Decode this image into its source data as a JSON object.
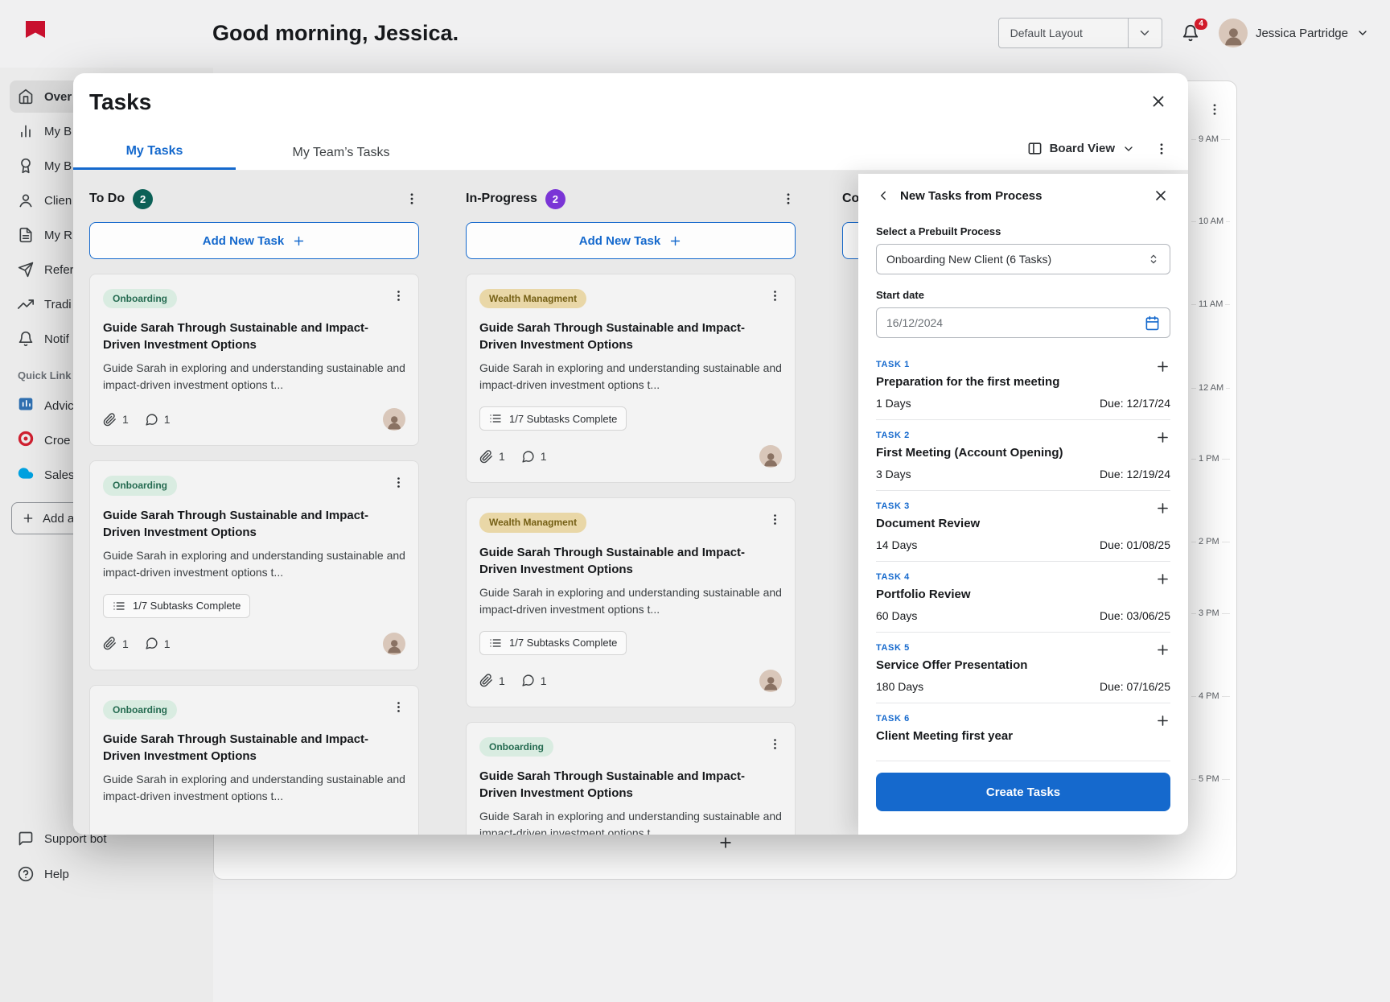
{
  "colors": {
    "accent": "#1569cd",
    "todo_badge": "#0c6157",
    "inprogress_badge": "#7a35d6",
    "onboarding_tag_bg": "#d9ece1",
    "onboarding_tag_text": "#256b51",
    "wealth_tag_bg": "#e9d7a7",
    "wealth_tag_text": "#756016",
    "notification_badge": "#d11a2a",
    "logo_red": "#c8102e"
  },
  "header": {
    "greeting": "Good morning, Jessica.",
    "layout_select": "Default Layout",
    "notification_count": "4",
    "user_name": "Jessica Partridge"
  },
  "sidebar": {
    "items": [
      {
        "label": "Over"
      },
      {
        "label": "My B"
      },
      {
        "label": "My B"
      },
      {
        "label": "Clien"
      },
      {
        "label": "My R"
      },
      {
        "label": "Refer"
      },
      {
        "label": "Tradi"
      },
      {
        "label": "Notif"
      }
    ],
    "section_label": "Quick Link",
    "quick_links": [
      {
        "label": "Advic"
      },
      {
        "label": "Croe"
      },
      {
        "label": "Sales"
      }
    ],
    "add_button_label": "Add a",
    "support_label": "Support bot",
    "help_label": "Help"
  },
  "timeline": {
    "times": [
      "9 AM",
      "10 AM",
      "11 AM",
      "12 AM",
      "1 PM",
      "2 PM",
      "3 PM",
      "4 PM",
      "5 PM"
    ]
  },
  "modal": {
    "title": "Tasks",
    "tabs": [
      {
        "label": "My Tasks"
      },
      {
        "label": "My Team’s Tasks"
      }
    ],
    "view_label": "Board View",
    "add_task_label": "Add New Task",
    "columns": [
      {
        "name": "To Do",
        "count": "2",
        "cards": [
          {
            "tag": "Onboarding",
            "title": "Guide Sarah Through Sustainable and Impact-Driven Investment Options",
            "desc": "Guide Sarah in exploring and understanding sustainable and impact-driven investment options t...",
            "attachments": "1",
            "comments": "1"
          },
          {
            "tag": "Onboarding",
            "title": "Guide Sarah Through Sustainable and Impact-Driven Investment Options",
            "desc": "Guide Sarah in exploring and understanding sustainable and impact-driven investment options t...",
            "subtasks": "1/7 Subtasks Complete",
            "attachments": "1",
            "comments": "1"
          },
          {
            "tag": "Onboarding",
            "title": "Guide Sarah Through Sustainable and Impact-Driven Investment Options",
            "desc": "Guide Sarah in exploring and understanding sustainable and impact-driven investment options t..."
          }
        ]
      },
      {
        "name": "In-Progress",
        "count": "2",
        "cards": [
          {
            "tag": "Wealth Managment",
            "title": "Guide Sarah Through Sustainable and Impact-Driven Investment Options",
            "desc": "Guide Sarah in exploring and understanding sustainable and impact-driven investment options t...",
            "subtasks": "1/7 Subtasks Complete",
            "attachments": "1",
            "comments": "1"
          },
          {
            "tag": "Wealth Managment",
            "title": "Guide Sarah Through Sustainable and Impact-Driven Investment Options",
            "desc": "Guide Sarah in exploring and understanding sustainable and impact-driven investment options t...",
            "subtasks": "1/7 Subtasks Complete",
            "attachments": "1",
            "comments": "1"
          },
          {
            "tag": "Onboarding",
            "title": "Guide Sarah Through Sustainable and Impact-Driven Investment Options",
            "desc": "Guide Sarah in exploring and understanding sustainable and impact-driven investment options t..."
          }
        ]
      },
      {
        "name": "Completed",
        "count": "",
        "cards": []
      }
    ]
  },
  "panel": {
    "title": "New Tasks from Process",
    "process_label": "Select a Prebuilt Process",
    "process_value": "Onboarding New Client (6 Tasks)",
    "start_date_label": "Start date",
    "start_date_value": "16/12/2024",
    "tasks": [
      {
        "num": "TASK 1",
        "title": "Preparation for the first meeting",
        "days": "1 Days",
        "due": "Due: 12/17/24"
      },
      {
        "num": "TASK 2",
        "title": "First Meeting (Account Opening)",
        "days": "3 Days",
        "due": "Due: 12/19/24"
      },
      {
        "num": "TASK 3",
        "title": "Document Review",
        "days": "14 Days",
        "due": "Due: 01/08/25"
      },
      {
        "num": "TASK 4",
        "title": "Portfolio Review",
        "days": "60 Days",
        "due": "Due: 03/06/25"
      },
      {
        "num": "TASK 5",
        "title": "Service Offer Presentation",
        "days": "180 Days",
        "due": "Due: 07/16/25"
      },
      {
        "num": "TASK 6",
        "title": "Client Meeting first year",
        "days": "",
        "due": ""
      }
    ],
    "create_button": "Create Tasks"
  }
}
